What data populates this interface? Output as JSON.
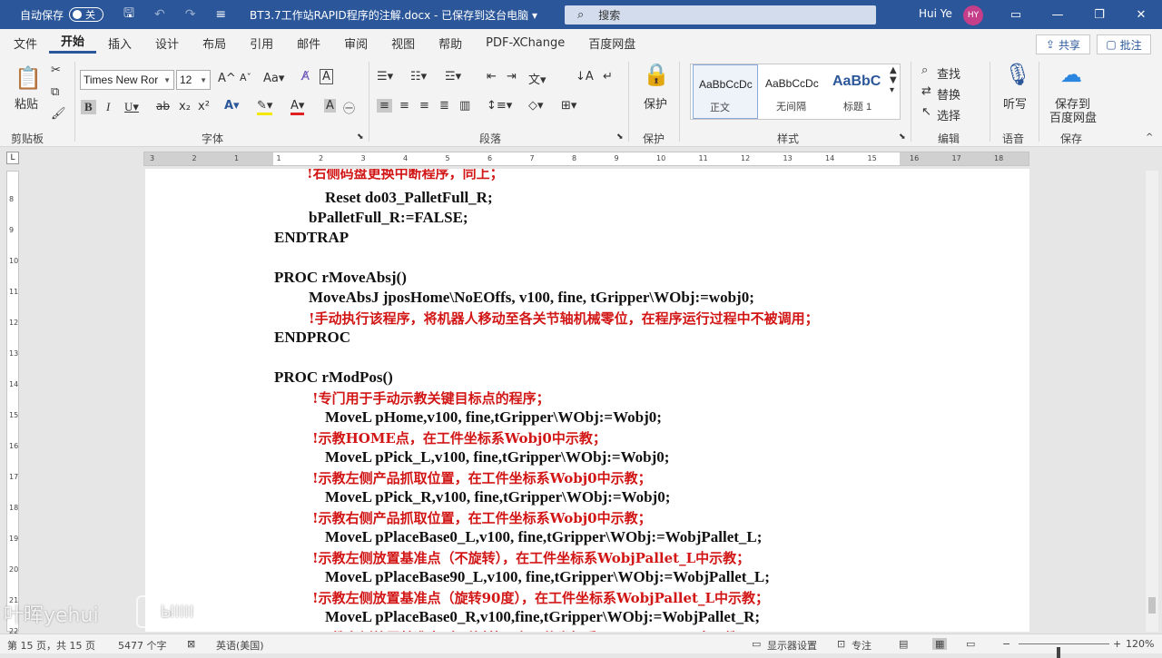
{
  "titlebar": {
    "autosave_label": "自动保存",
    "autosave_state": "关",
    "doc_title": "BT3.7工作站RAPID程序的注解.docx - 已保存到这台电脑 ▾",
    "search_placeholder": "搜索",
    "user_name": "Hui Ye",
    "avatar_initials": "HY"
  },
  "tabs": [
    "文件",
    "开始",
    "插入",
    "设计",
    "布局",
    "引用",
    "邮件",
    "审阅",
    "视图",
    "帮助",
    "PDF-XChange",
    "百度网盘"
  ],
  "active_tab": "开始",
  "share_label": "共享",
  "comment_label": "批注",
  "ribbon": {
    "paste_label": "粘贴",
    "clipboard_group": "剪贴板",
    "font_name": "Times New Ror",
    "font_size": "12",
    "font_group": "字体",
    "paragraph_group": "段落",
    "protect_label": "保护",
    "protect_group": "保护",
    "styles": [
      {
        "preview": "AaBbCcDc",
        "name": "正文"
      },
      {
        "preview": "AaBbCcDc",
        "name": "无间隔"
      },
      {
        "preview": "AaBbC",
        "name": "标题 1"
      }
    ],
    "styles_group": "样式",
    "find_label": "查找",
    "replace_label": "替换",
    "select_label": "选择",
    "edit_group": "编辑",
    "dictate_label": "听写",
    "voice_group": "语音",
    "save_baidu_label1": "保存到",
    "save_baidu_label2": "百度网盘",
    "save_group": "保存"
  },
  "ruler_ticks": [
    "3",
    "2",
    "1",
    "1",
    "2",
    "3",
    "4",
    "5",
    "6",
    "7",
    "8",
    "9",
    "10",
    "11",
    "12",
    "13",
    "14",
    "15",
    "16",
    "17",
    "18"
  ],
  "vruler_ticks": [
    "8",
    "9",
    "10",
    "11",
    "12",
    "13",
    "14",
    "15",
    "16",
    "17",
    "18",
    "19",
    "20",
    "21",
    "22"
  ],
  "document": {
    "lines": [
      {
        "text": "!右侧码盘更换中断程序，同上；",
        "type": "comment"
      },
      {
        "text": "Reset do03_PalletFull_R;",
        "type": "code"
      },
      {
        "text": "bPalletFull_R:=FALSE;",
        "type": "code"
      },
      {
        "text": "ENDTRAP",
        "type": "code"
      },
      {
        "text": "PROC rMoveAbsj()",
        "type": "code"
      },
      {
        "text": "MoveAbsJ jposHome\\NoEOffs, v100, fine, tGripper\\WObj:=wobj0;",
        "type": "code"
      },
      {
        "text": "!手动执行该程序，将机器人移动至各关节轴机械零位，在程序运行过程中不被调用；",
        "type": "comment"
      },
      {
        "text": "ENDPROC",
        "type": "code"
      },
      {
        "text": "PROC rModPos()",
        "type": "code"
      },
      {
        "text": "!专门用于手动示教关键目标点的程序；",
        "type": "comment"
      },
      {
        "text": "MoveL pHome,v100, fine,tGripper\\WObj:=Wobj0;",
        "type": "code"
      },
      {
        "text": "!示教HOME点，在工件坐标系Wobj0中示教；",
        "type": "comment"
      },
      {
        "text": "MoveL pPick_L,v100, fine,tGripper\\WObj:=Wobj0;",
        "type": "code"
      },
      {
        "text": "!示教左侧产品抓取位置，在工件坐标系Wobj0中示教；",
        "type": "comment"
      },
      {
        "text": "MoveL pPick_R,v100, fine,tGripper\\WObj:=Wobj0;",
        "type": "code"
      },
      {
        "text": "!示教右侧产品抓取位置，在工件坐标系Wobj0中示教；",
        "type": "comment"
      },
      {
        "text": "MoveL pPlaceBase0_L,v100, fine,tGripper\\WObj:=WobjPallet_L;",
        "type": "code"
      },
      {
        "text": "!示教左侧放置基准点（不旋转），在工件坐标系WobjPallet_L中示教；",
        "type": "comment"
      },
      {
        "text": "MoveL pPlaceBase90_L,v100, fine,tGripper\\WObj:=WobjPallet_L;",
        "type": "code"
      },
      {
        "text": "!示教左侧放置基准点（旋转90度），在工件坐标系WobjPallet_L中示教；",
        "type": "comment"
      },
      {
        "text": "MoveL pPlaceBase0_R,v100,fine,tGripper\\WObj:=WobjPallet_R;",
        "type": "code"
      },
      {
        "text": "!示教右侧放置基准点（不旋转），在工件坐标系WobjPallet_R中示教；",
        "type": "comment"
      }
    ]
  },
  "watermark": {
    "text": "叶晖yehui",
    "logo": "ЫIIII"
  },
  "status": {
    "page": "第 15 页，共 15 页",
    "words": "5477 个字",
    "lang": "英语(美国)",
    "display_settings": "显示器设置",
    "focus": "专注",
    "zoom": "120%"
  },
  "zoom_fraction": 0.44
}
